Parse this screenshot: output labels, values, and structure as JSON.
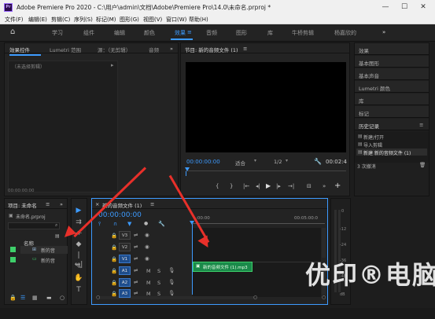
{
  "title_bar": {
    "app_icon": "Pr",
    "title": "Adobe Premiere Pro 2020 - C:\\用户\\admin\\文档\\Adobe\\Premiere Pro\\14.0\\未命名.prproj *",
    "minimize": "—",
    "maximize": "☐",
    "close": "✕"
  },
  "menu": [
    "文件(F)",
    "编辑(E)",
    "剪辑(C)",
    "序列(S)",
    "标记(M)",
    "图形(G)",
    "视图(V)",
    "窗口(W)",
    "帮助(H)"
  ],
  "workspaces": {
    "home": "⌂",
    "tabs": [
      "学习",
      "组件",
      "编辑",
      "颜色",
      "效果",
      "音频",
      "图形",
      "库",
      "牛桥剪辑",
      "杨嘉欣的"
    ],
    "active_index": 4,
    "more": "»",
    "menu_symbol": "≡"
  },
  "source_panel": {
    "tabs": [
      "效果控件",
      "Lumetri 范围",
      "源：（无剪辑）",
      "音频"
    ],
    "more": "»",
    "no_clip": "（未选择剪辑）",
    "expand": "▸",
    "timecode": "00:00:00:00"
  },
  "program_monitor": {
    "title": "节目: 新的音频文件 (1)",
    "timecode_left": "00:00:00:00",
    "fit": "适合",
    "resolution": "1/2",
    "timecode_right": "00:02:4",
    "transport": [
      "{",
      "}",
      "|←",
      "◂|",
      "▶",
      "|▸",
      "→|",
      "⊟",
      "»",
      "+"
    ]
  },
  "right_panels": {
    "items": [
      "效果",
      "基本图形",
      "基本声音",
      "Lumetri 颜色",
      "库",
      "标记"
    ],
    "history": {
      "title": "历史记录",
      "menu": "≡",
      "entries": [
        "新建/打开",
        "导入剪辑",
        "新建 新的音频文件 (1)"
      ],
      "undo_count": "3 次撤消",
      "trash": "🗑"
    }
  },
  "project_panel": {
    "title": "项目: 未命名",
    "menu": "≡",
    "more": "»",
    "file": "未命名.prproj",
    "name_header": "名称",
    "items": [
      "新的音",
      "新的音"
    ]
  },
  "timeline": {
    "close": "×",
    "title": "新的音频文件 (1)",
    "menu": "≡",
    "timecode": "00:00:00:00",
    "ruler_start": ":00:00",
    "ruler_end": "00:05:00:0",
    "video_tracks": [
      "V3",
      "V2",
      "V1"
    ],
    "audio_tracks": [
      "A1",
      "A2",
      "A3"
    ],
    "audio_marks": [
      "M",
      "S"
    ],
    "mic": "🎙",
    "clip_label": "新的音频文件 (1).mp3"
  },
  "meter": {
    "labels": [
      "0",
      "-12",
      "-24",
      "-36",
      "-48",
      "dB"
    ]
  },
  "watermark": "优印®电脑",
  "colors": {
    "accent": "#3d9bff",
    "annotation": "#e8302a",
    "clip": "#1a8a4a",
    "clip_highlight": "#3ecf6a"
  }
}
